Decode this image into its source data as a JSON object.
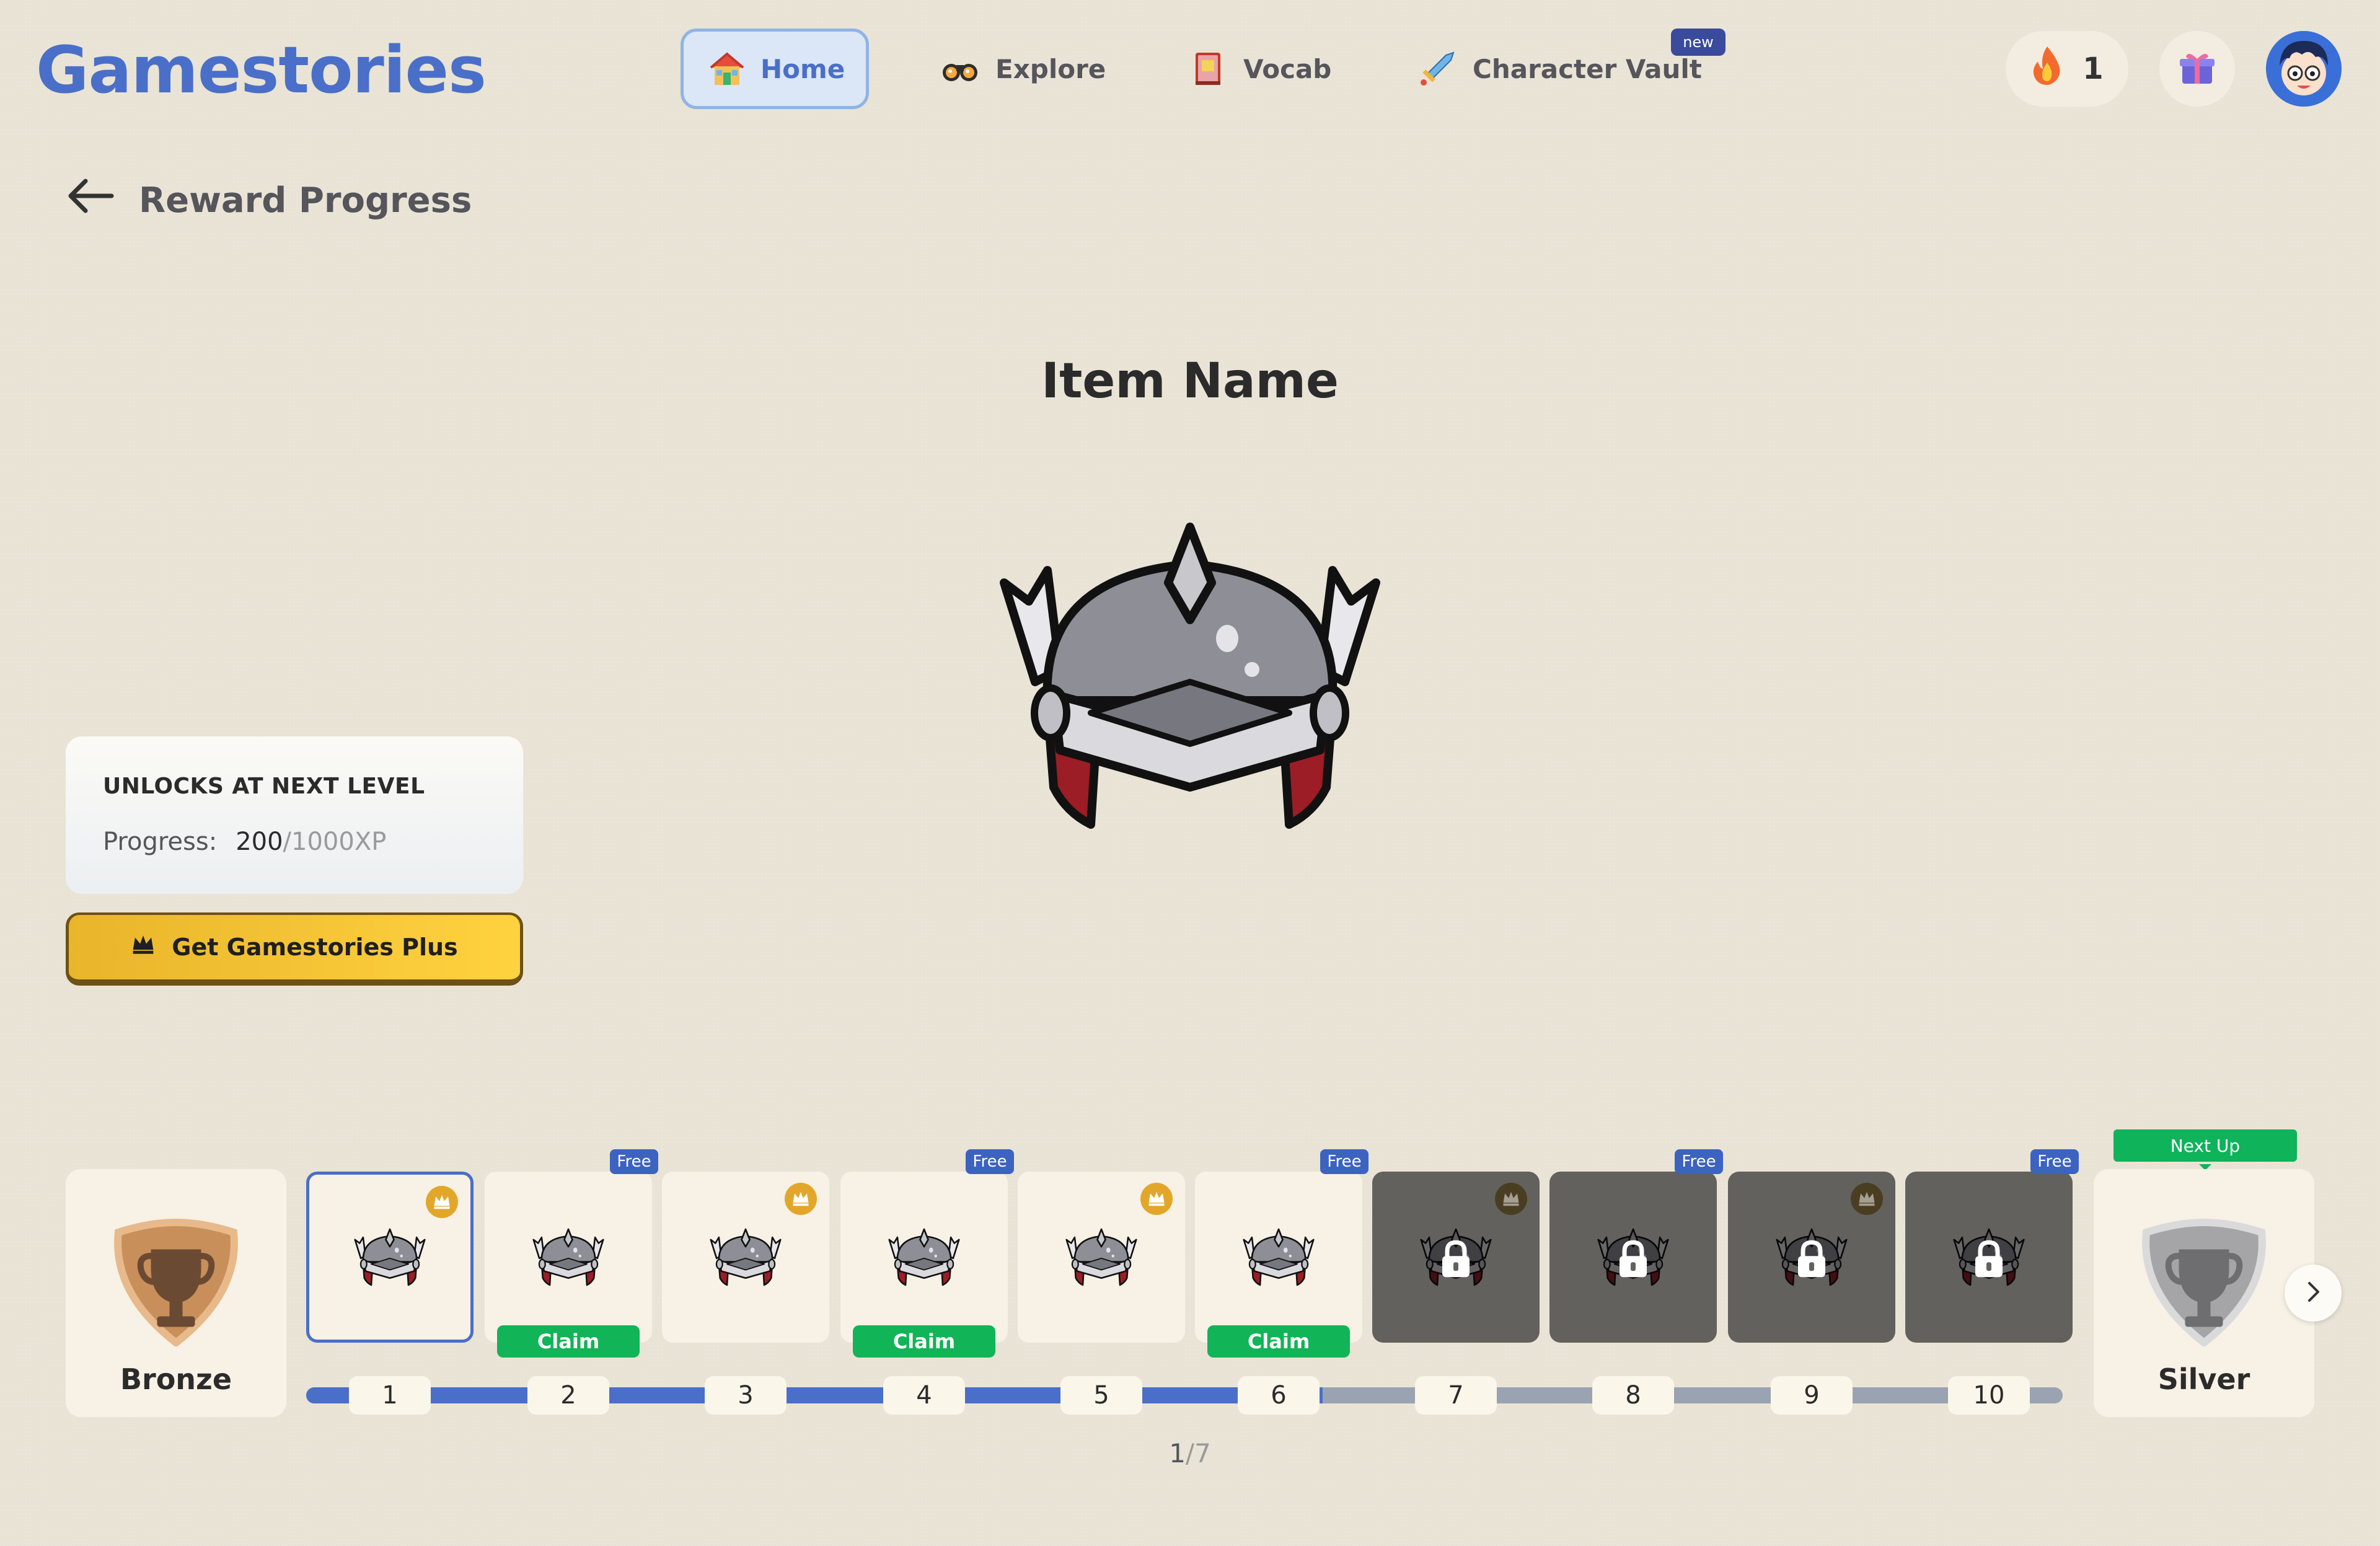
{
  "app": {
    "title": "Gamestories"
  },
  "nav": {
    "items": [
      {
        "label": "Home",
        "icon": "house-icon",
        "active": true
      },
      {
        "label": "Explore",
        "icon": "binoculars-icon"
      },
      {
        "label": "Vocab",
        "icon": "book-icon"
      },
      {
        "label": "Character Vault",
        "icon": "sword-icon",
        "badge": "new"
      }
    ]
  },
  "header": {
    "streak_count": "1",
    "streak_icon": "flame-icon",
    "gift_icon": "gift-icon",
    "avatar_icon": "avatar-icon"
  },
  "page": {
    "back_title": "Reward Progress",
    "item_name": "Item Name"
  },
  "unlock": {
    "title": "UNLOCKS AT NEXT LEVEL",
    "progress_label": "Progress:",
    "progress_current": "200",
    "progress_total": "/1000XP"
  },
  "plus_button": {
    "label": "Get Gamestories Plus",
    "icon": "crown-icon"
  },
  "tiers": {
    "current": {
      "label": "Bronze",
      "icon": "bronze-trophy-shield-icon"
    },
    "next": {
      "label": "Silver",
      "icon": "silver-trophy-shield-icon",
      "tag": "Next Up"
    }
  },
  "levels": [
    "1",
    "2",
    "3",
    "4",
    "5",
    "6",
    "7",
    "8",
    "9",
    "10"
  ],
  "rewards": {
    "free_tag": "Free",
    "claim_label": "Claim"
  },
  "progress_levels_completed": 6,
  "pager": {
    "current": "1",
    "separator": "/",
    "total": "7"
  },
  "colors": {
    "background": "#e9e4d6",
    "brand_blue": "#4a6fc8",
    "claim_green": "#11b456",
    "premium_gold": "#e2a72a",
    "locked_gray": "#62615e"
  }
}
